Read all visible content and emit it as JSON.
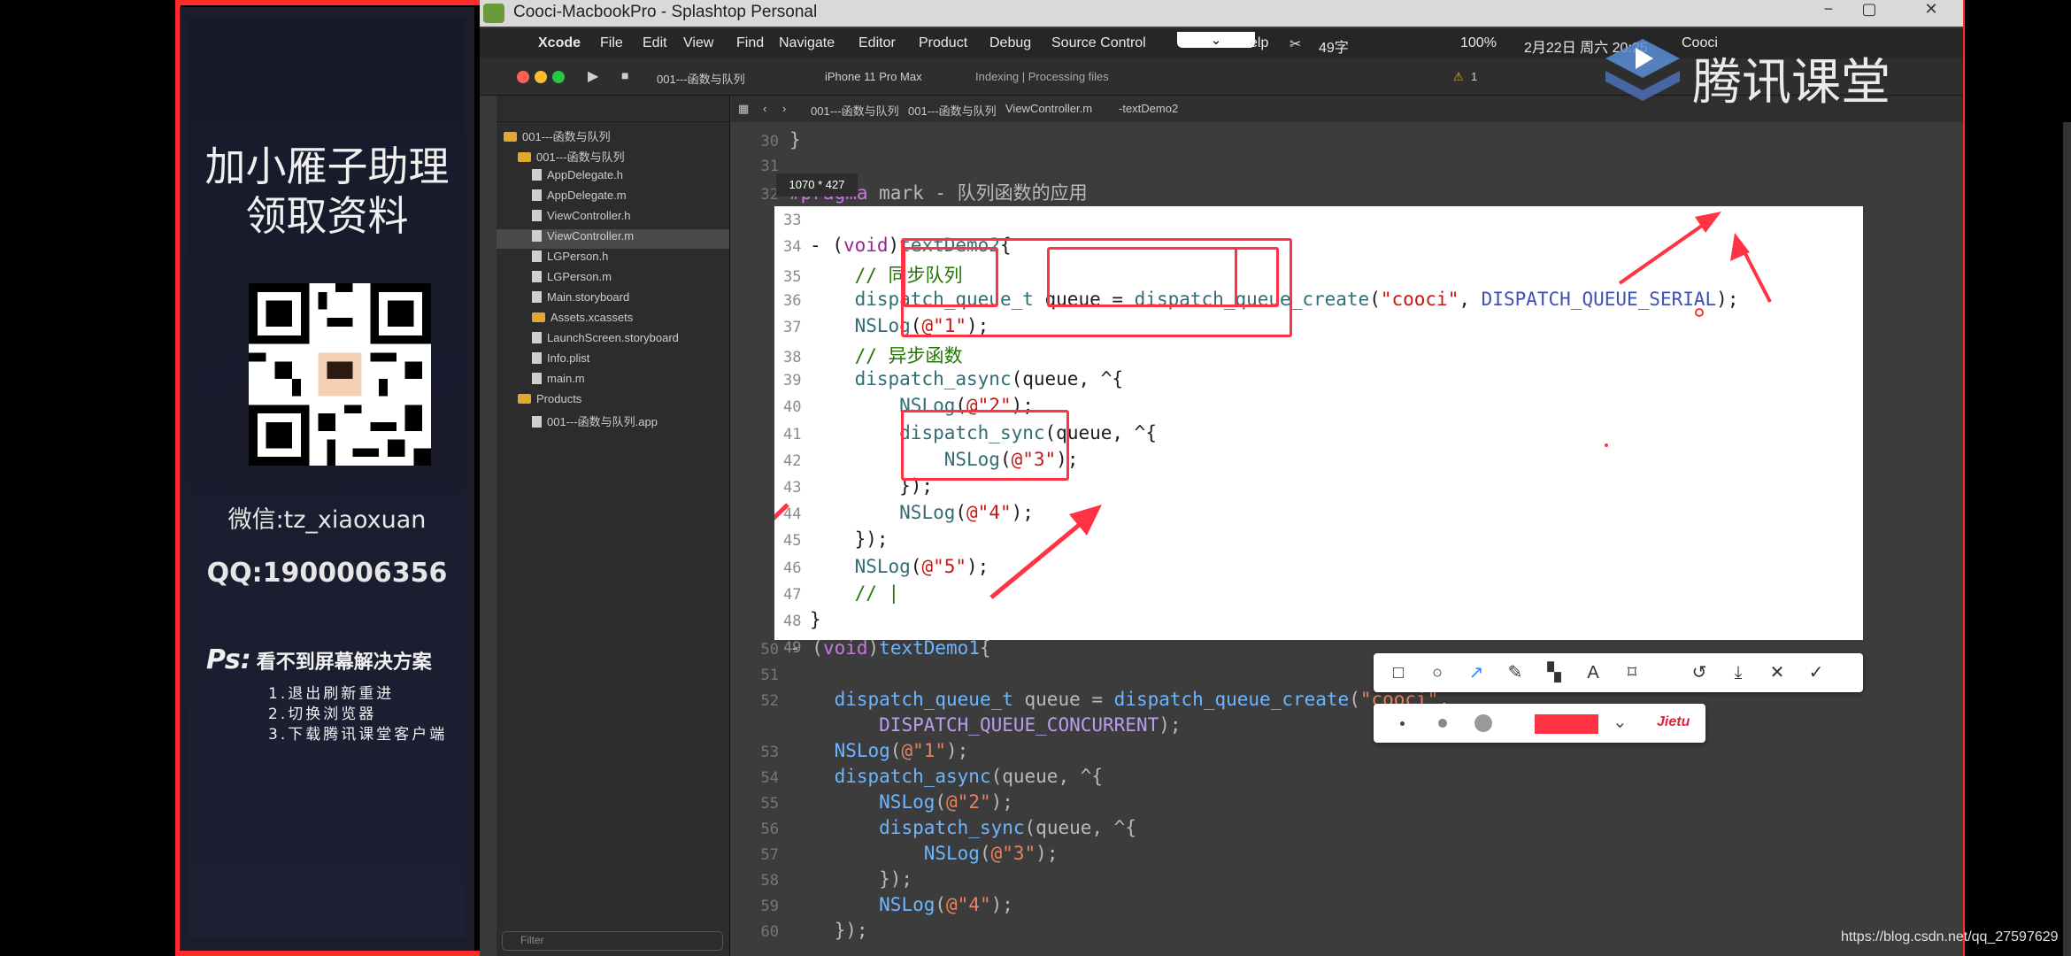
{
  "window": {
    "title": "Cooci-MacbookPro - Splashtop Personal"
  },
  "promo": {
    "title_line1": "加小雁子助理",
    "title_line2": "领取资料",
    "wechat": "微信:tz_xiaoxuan",
    "qq": "QQ:1900006356",
    "ps_label": "Ps:",
    "ps_title": "看不到屏幕解决方案",
    "ps_items": [
      "1.退出刷新重进",
      "2.切换浏览器",
      "3.下载腾讯课堂客户端"
    ]
  },
  "menubar": {
    "app": "Xcode",
    "items": [
      "File",
      "Edit",
      "View",
      "Find",
      "Navigate",
      "Editor",
      "Product",
      "Debug",
      "Source Control"
    ],
    "help_fragment": "elp",
    "battery": "100%",
    "date_fragment": "2月22日 周六 20:25",
    "user": "Cooci",
    "input_hint": "49字"
  },
  "toolbar": {
    "scheme": "001---函数与队列",
    "device": "iPhone 11 Pro Max",
    "status": "Indexing | Processing files",
    "warning_count": "1"
  },
  "navigator": {
    "items": [
      {
        "label": "001---函数与队列",
        "type": "project",
        "indent": 0
      },
      {
        "label": "001---函数与队列",
        "type": "folder",
        "indent": 1
      },
      {
        "label": "AppDelegate.h",
        "type": "file",
        "indent": 2
      },
      {
        "label": "AppDelegate.m",
        "type": "file",
        "indent": 2
      },
      {
        "label": "ViewController.h",
        "type": "file",
        "indent": 2
      },
      {
        "label": "ViewController.m",
        "type": "file",
        "indent": 2,
        "selected": true
      },
      {
        "label": "LGPerson.h",
        "type": "file",
        "indent": 2
      },
      {
        "label": "LGPerson.m",
        "type": "file",
        "indent": 2
      },
      {
        "label": "Main.storyboard",
        "type": "file",
        "indent": 2
      },
      {
        "label": "Assets.xcassets",
        "type": "folder",
        "indent": 2
      },
      {
        "label": "LaunchScreen.storyboard",
        "type": "file",
        "indent": 2
      },
      {
        "label": "Info.plist",
        "type": "file",
        "indent": 2
      },
      {
        "label": "main.m",
        "type": "file",
        "indent": 2
      },
      {
        "label": "Products",
        "type": "folder",
        "indent": 1
      },
      {
        "label": "001---函数与队列.app",
        "type": "file",
        "indent": 2
      }
    ],
    "filter_placeholder": "Filter"
  },
  "jumpbar": {
    "crumbs": [
      "001---函数与队列",
      "001---函数与队列",
      "ViewController.m",
      "-textDemo2"
    ]
  },
  "capture_label": "1070 * 427",
  "code_top": [
    {
      "n": "30",
      "t": "}"
    },
    {
      "n": "31",
      "t": ""
    },
    {
      "n": "32",
      "t": "#pragma mark - 队列函数的应用"
    }
  ],
  "code_capture": [
    {
      "n": "33",
      "t": ""
    },
    {
      "n": "34",
      "t": "- (void)textDemo2{"
    },
    {
      "n": "35",
      "t": "    // 同步队列"
    },
    {
      "n": "36",
      "t": "    dispatch_queue_t queue = dispatch_queue_create(\"cooci\", DISPATCH_QUEUE_SERIAL);"
    },
    {
      "n": "37",
      "t": "    NSLog(@\"1\");"
    },
    {
      "n": "38",
      "t": "    // 异步函数"
    },
    {
      "n": "39",
      "t": "    dispatch_async(queue, ^{"
    },
    {
      "n": "40",
      "t": "        NSLog(@\"2\");"
    },
    {
      "n": "41",
      "t": "        dispatch_sync(queue, ^{"
    },
    {
      "n": "42",
      "t": "            NSLog(@\"3\");"
    },
    {
      "n": "43",
      "t": "        });"
    },
    {
      "n": "44",
      "t": "        NSLog(@\"4\");"
    },
    {
      "n": "45",
      "t": "    });"
    },
    {
      "n": "46",
      "t": "    NSLog(@\"5\");"
    },
    {
      "n": "47",
      "t": "    // |"
    },
    {
      "n": "48",
      "t": "}"
    },
    {
      "n": "49",
      "t": ""
    }
  ],
  "code_bottom": [
    {
      "n": "50",
      "t": "- (void)textDemo1{"
    },
    {
      "n": "51",
      "t": ""
    },
    {
      "n": "52",
      "t": "    dispatch_queue_t queue = dispatch_queue_create(\"cooci\","
    },
    {
      "n": "",
      "t": "        DISPATCH_QUEUE_CONCURRENT);"
    },
    {
      "n": "53",
      "t": "    NSLog(@\"1\");"
    },
    {
      "n": "54",
      "t": "    dispatch_async(queue, ^{"
    },
    {
      "n": "55",
      "t": "        NSLog(@\"2\");"
    },
    {
      "n": "56",
      "t": "        dispatch_sync(queue, ^{"
    },
    {
      "n": "57",
      "t": "            NSLog(@\"3\");"
    },
    {
      "n": "58",
      "t": "        });"
    },
    {
      "n": "59",
      "t": "        NSLog(@\"4\");"
    },
    {
      "n": "60",
      "t": "    });"
    }
  ],
  "tools": {
    "brand": "Jietu",
    "selected_color": "#ff3344"
  },
  "watermark": {
    "text": "腾讯课堂"
  },
  "csdn_url": "https://blog.csdn.net/qq_27597629"
}
